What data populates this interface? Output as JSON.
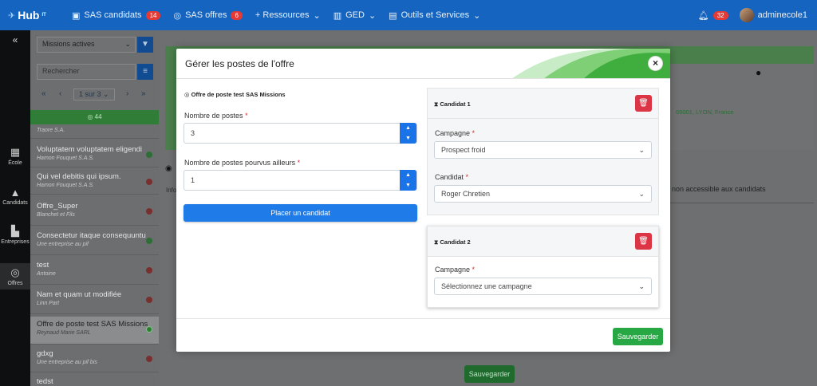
{
  "app": {
    "logo": "Hub",
    "logo_sup": "IT"
  },
  "nav": [
    {
      "label": "SAS candidats",
      "badge": "14",
      "icon": "users-icon"
    },
    {
      "label": "SAS offres",
      "badge": "6",
      "icon": "target-icon"
    },
    {
      "label": "+ Ressources",
      "icon": "plus-icon"
    },
    {
      "label": "GED",
      "icon": "book-icon"
    },
    {
      "label": "Outils et Services",
      "icon": "briefcase-icon"
    }
  ],
  "user": {
    "name": "adminecole1",
    "notif_count": "32"
  },
  "rail": [
    {
      "label": "École"
    },
    {
      "label": "Candidats"
    },
    {
      "label": "Entreprises"
    },
    {
      "label": "Offres"
    }
  ],
  "listpanel": {
    "filter": "Missions actives",
    "search_placeholder": "Rechercher",
    "pager": "1 sur 3",
    "count": "44",
    "items": [
      {
        "title": "",
        "sub": "Traore S.A."
      },
      {
        "title": "Voluptatem voluptatem eligendi",
        "sub": "Hamon Fouquet S.A.S."
      },
      {
        "title": "Qui vel debitis qui ipsum.",
        "sub": "Hamon Fouquet S.A.S."
      },
      {
        "title": "Offre_Super",
        "sub": "Blanchet et Fils"
      },
      {
        "title": "Consectetur itaque consequuntu",
        "sub": "Une entreprise au pif"
      },
      {
        "title": "test",
        "sub": "Antoine"
      },
      {
        "title": "Nam et quam ut modifiée",
        "sub": "Linn Part"
      },
      {
        "title": "Offre de poste test SAS Missions",
        "sub": "Reynaud Marie SARL"
      },
      {
        "title": "gdxg",
        "sub": "Une entreprise au pif bis"
      },
      {
        "title": "tedst",
        "sub": ""
      }
    ]
  },
  "background": {
    "address": "69001, LYON, France",
    "non_accessible": "non accessible aux candidats",
    "save": "Sauvegarder",
    "info_tab": "Info"
  },
  "modal": {
    "title": "Gérer les postes de l'offre",
    "offer_title": "Offre de poste test SAS Missions",
    "nb_postes_label": "Nombre de postes",
    "nb_postes_value": "3",
    "nb_ailleurs_label": "Nombre de postes pourvus ailleurs",
    "nb_ailleurs_value": "1",
    "place_btn": "Placer un candidat",
    "save_btn": "Sauvegarder",
    "candidats": [
      {
        "title": "Candidat 1",
        "campagne_label": "Campagne",
        "campagne_value": "Prospect froid",
        "candidat_label": "Candidat",
        "candidat_value": "Roger Chretien"
      },
      {
        "title": "Candidat 2",
        "campagne_label": "Campagne",
        "campagne_value": "Sélectionnez une campagne"
      }
    ]
  }
}
